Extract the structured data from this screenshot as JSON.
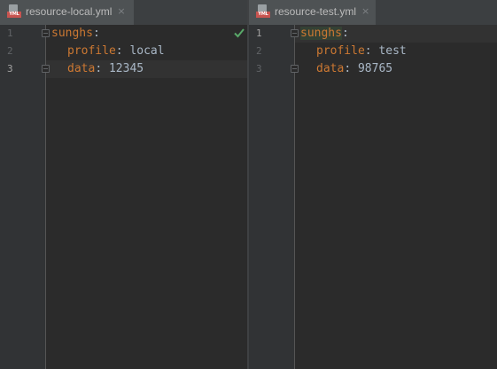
{
  "left_pane": {
    "tab": {
      "icon": "yml-file-icon",
      "title": "resource-local.yml",
      "close_glyph": "×"
    },
    "line_numbers": [
      "1",
      "2",
      "3"
    ],
    "current_line": 3,
    "inspection_status_icon": "checkmark-icon",
    "lines": [
      {
        "key": "sunghs",
        "sep": ":",
        "value": ""
      },
      {
        "key": "profile",
        "sep": ": ",
        "value": "local"
      },
      {
        "key": "data",
        "sep": ": ",
        "value": "12345"
      }
    ]
  },
  "right_pane": {
    "tab": {
      "icon": "yml-file-icon",
      "title": "resource-test.yml",
      "close_glyph": "×"
    },
    "line_numbers": [
      "1",
      "2",
      "3"
    ],
    "current_line": 1,
    "lines": [
      {
        "key": "sunghs",
        "sep": ":",
        "value": ""
      },
      {
        "key": "profile",
        "sep": ": ",
        "value": "test"
      },
      {
        "key": "data",
        "sep": ": ",
        "value": "98765"
      }
    ]
  },
  "file_type_badge": "YML",
  "colors": {
    "background": "#2b2b2b",
    "gutter": "#313335",
    "tab_active": "#4e5254",
    "yaml_key": "#cc7832",
    "text": "#a9b7c6",
    "line_number": "#606366",
    "checkmark": "#59a869"
  }
}
